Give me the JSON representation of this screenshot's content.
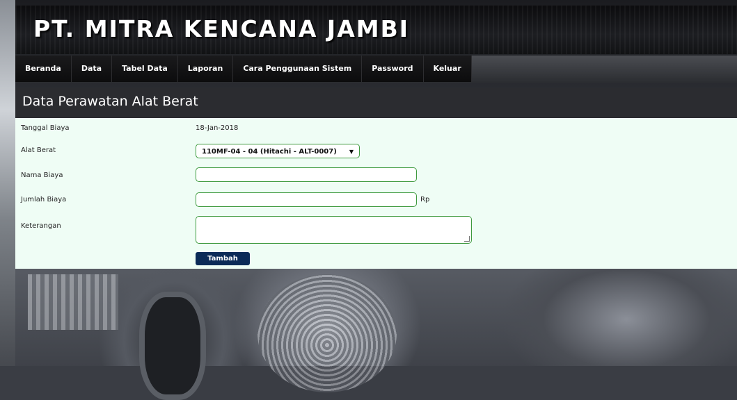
{
  "header": {
    "site_title": "PT. MITRA KENCANA JAMBI"
  },
  "nav": {
    "items": [
      {
        "label": "Beranda"
      },
      {
        "label": "Data"
      },
      {
        "label": "Tabel Data"
      },
      {
        "label": "Laporan"
      },
      {
        "label": "Cara Penggunaan Sistem"
      },
      {
        "label": "Password"
      },
      {
        "label": "Keluar"
      }
    ]
  },
  "page": {
    "title": "Data Perawatan Alat Berat"
  },
  "form": {
    "tanggal_label": "Tanggal Biaya",
    "tanggal_value": "18-Jan-2018",
    "alat_label": "Alat Berat",
    "alat_selected": "110MF-04 - 04 (Hitachi - ALT-0007)",
    "nama_label": "Nama Biaya",
    "nama_value": "",
    "jumlah_label": "Jumlah Biaya",
    "jumlah_value": "",
    "currency_label": "Rp",
    "keterangan_label": "Keterangan",
    "keterangan_value": "",
    "submit_label": "Tambah"
  },
  "colors": {
    "form_bg": "#effdf5",
    "input_border": "#3e9a3e",
    "button_bg": "#0b2a57",
    "title_bar_bg": "#2b2c30"
  }
}
